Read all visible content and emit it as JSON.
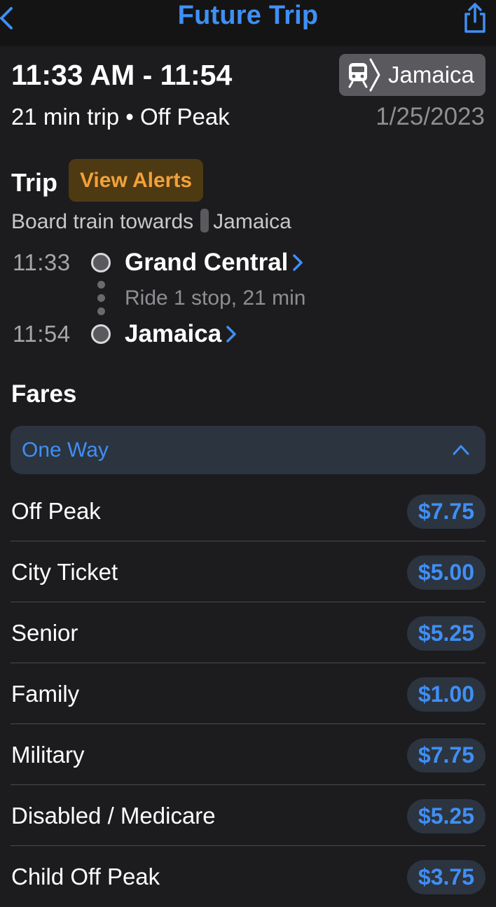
{
  "nav": {
    "title": "Future Trip",
    "back_icon": "chevron-left-icon",
    "share_icon": "share-icon"
  },
  "summary": {
    "times": "11:33 AM - 11:54",
    "destination": "Jamaica",
    "destination_icon": "train-icon",
    "subline": "21 min trip • Off Peak",
    "date": "1/25/2023"
  },
  "trip": {
    "heading": "Trip",
    "alerts_label": "View Alerts",
    "board_prefix": "Board train towards",
    "board_destination": "Jamaica",
    "ride_text": "Ride 1 stop, 21 min",
    "stops": [
      {
        "time": "11:33",
        "name": "Grand Central"
      },
      {
        "time": "11:54",
        "name": "Jamaica"
      }
    ]
  },
  "fares": {
    "heading": "Fares",
    "selector_label": "One Way",
    "items": [
      {
        "name": "Off Peak",
        "price": "$7.75"
      },
      {
        "name": "City Ticket",
        "price": "$5.00"
      },
      {
        "name": "Senior",
        "price": "$5.25"
      },
      {
        "name": "Family",
        "price": "$1.00"
      },
      {
        "name": "Military",
        "price": "$7.75"
      },
      {
        "name": "Disabled / Medicare",
        "price": "$5.25"
      },
      {
        "name": "Child Off Peak",
        "price": "$3.75"
      }
    ]
  },
  "colors": {
    "accent": "#3f8ff5",
    "background": "#1c1c1e",
    "alert": "#f2a13a"
  }
}
